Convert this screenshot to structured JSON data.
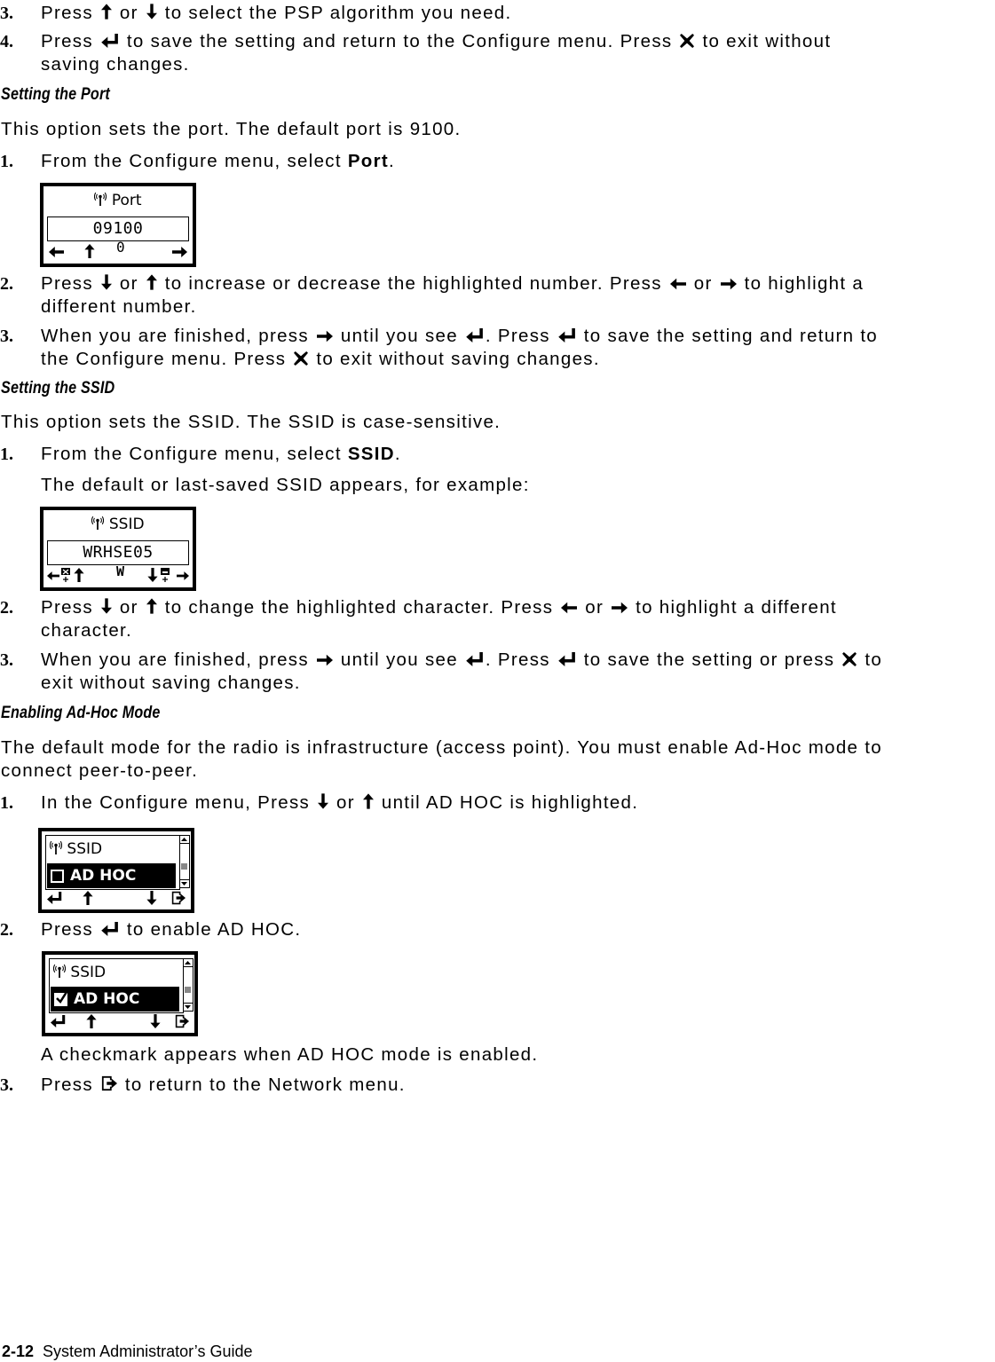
{
  "page": {
    "steps_top": [
      {
        "num": "3.",
        "parts": [
          "Press",
          "up-arrow",
          "or",
          "down-arrow",
          "to select the PSP algorithm you need."
        ]
      },
      {
        "num": "4.",
        "line1": [
          "Press",
          "enter",
          "to save the setting and return to the Configure menu. Press",
          "x",
          "to exit without"
        ],
        "line2": "saving changes."
      }
    ],
    "sections": {
      "port": {
        "heading": "Setting the Port",
        "intro": "This option sets the port. The default port is 9100.",
        "step1": {
          "num": "1.",
          "text": "From the Configure menu, select ",
          "bold": "Port",
          "end": "."
        },
        "lcd": {
          "title": "Port",
          "value": "09100",
          "softkeys": [
            "left-arrow",
            "up-arrow",
            "0",
            "right-arrow"
          ]
        },
        "step2": {
          "num": "2.",
          "line1": "Press {down} or {up} to increase or decrease the highlighted number. Press {left} or {right} to highlight a",
          "line2": "different number."
        },
        "step3": {
          "num": "3.",
          "line1": "When you are finished, press {right} until you see {enter}. Press {enter} to save the setting and return to",
          "line2": "the Configure menu. Press {x} to exit without saving changes."
        }
      },
      "ssid": {
        "heading": "Setting the SSID",
        "intro": "This option sets the SSID.  The SSID is case-sensitive.",
        "step1": {
          "num": "1.",
          "text": "From the Configure menu, select ",
          "bold": "SSID",
          "end": "."
        },
        "step1_note": "The default or last-saved SSID appears, for example:",
        "lcd": {
          "title": "SSID",
          "value": "WRHSE05",
          "softkeys": [
            "left-arrow",
            "delete-char",
            "up-arrow",
            "W",
            "down-arrow",
            "insert-char",
            "right-arrow"
          ]
        },
        "step2": {
          "num": "2.",
          "line1": "Press {down} or {up} to change the highlighted character. Press {left} or {right} to highlight a different",
          "line2": "character."
        },
        "step3": {
          "num": "3.",
          "line1": "When you are finished, press {right} until you see {enter}. Press {enter} to save the setting or press {x} to",
          "line2": "exit without saving changes."
        }
      },
      "adhoc": {
        "heading": "Enabling Ad-Hoc Mode",
        "intro_line1": "The default mode for the radio is infrastructure (access point). You must enable Ad-Hoc mode to",
        "intro_line2": "connect peer-to-peer.",
        "step1": {
          "num": "1.",
          "line1": "In the Configure menu, Press {down} or {up} until AD HOC is highlighted."
        },
        "lcd1": {
          "row1": "SSID",
          "row2": "AD HOC",
          "checked": false
        },
        "step2": {
          "num": "2.",
          "line1": "Press {enter} to enable AD HOC."
        },
        "lcd2": {
          "row1": "SSID",
          "row2": "AD HOC",
          "checked": true
        },
        "step2_note": "A checkmark appears when AD HOC mode is enabled.",
        "step3": {
          "num": "3.",
          "line1": "Press {exit} to return to the Network menu."
        }
      }
    },
    "footer": {
      "page_num": "2-12",
      "title": "System Administrator’s Guide"
    }
  }
}
